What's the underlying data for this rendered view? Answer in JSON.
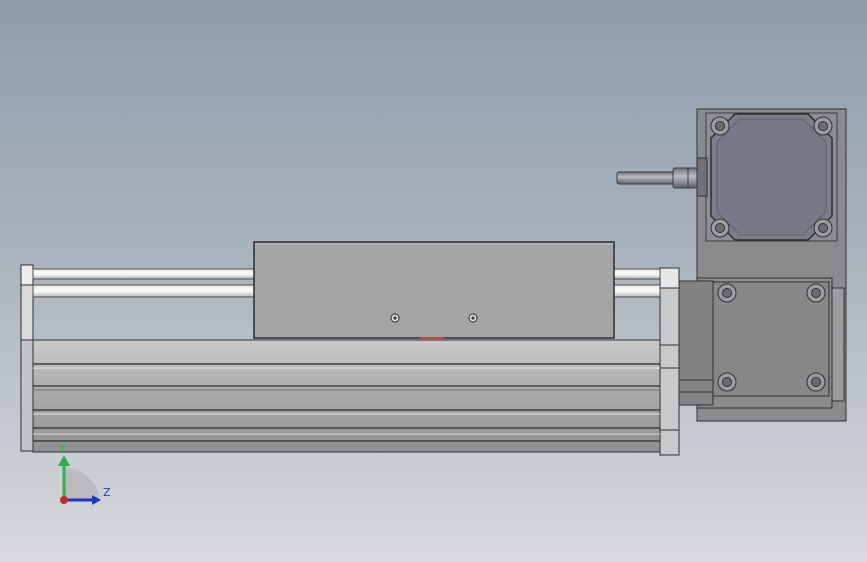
{
  "viewport": {
    "background_top": "#8e9cab",
    "background_bottom": "#d8dadd"
  },
  "triad": {
    "y_label": "Y",
    "z_label": "Z",
    "y_color": "#2db24a",
    "z_color": "#2036c8",
    "x_color": "#d0262a"
  }
}
